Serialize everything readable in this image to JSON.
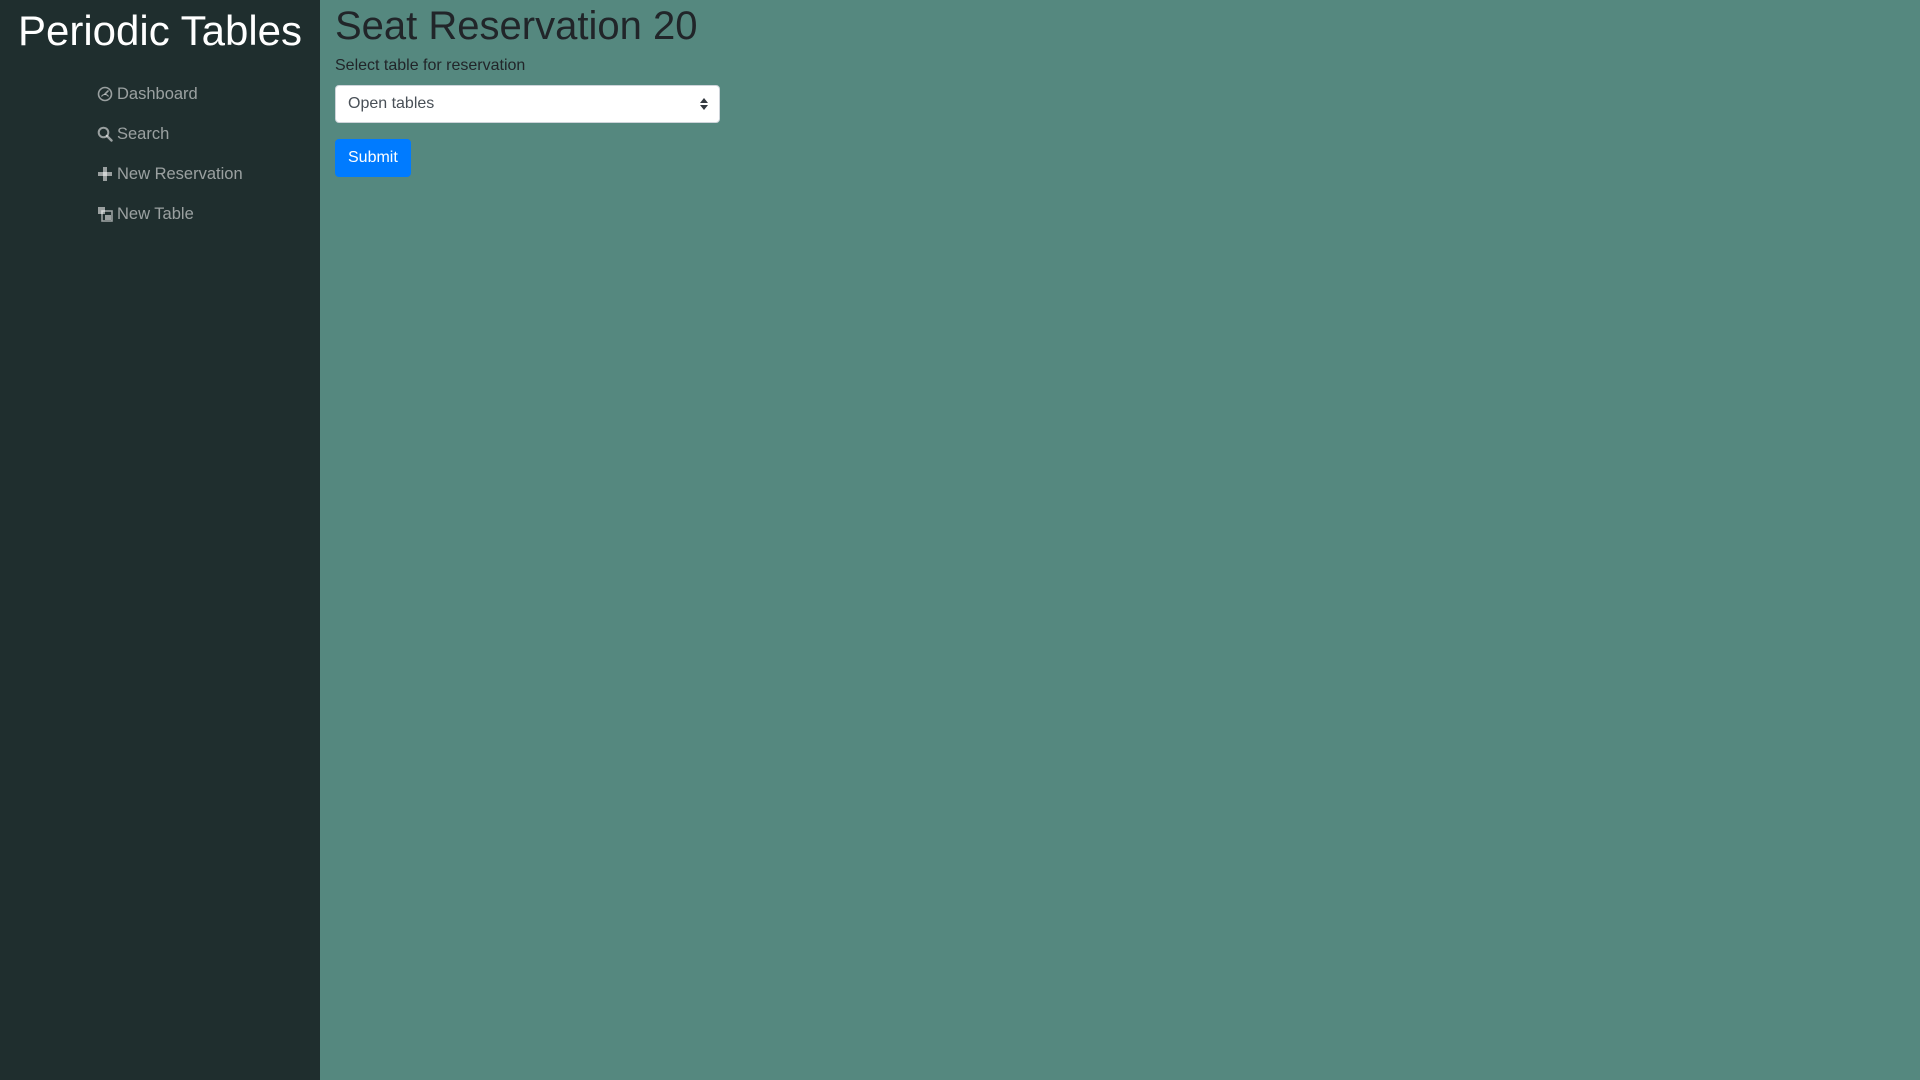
{
  "sidebar": {
    "brand": "Periodic Tables",
    "items": [
      {
        "label": "Dashboard",
        "icon": "dashboard-icon"
      },
      {
        "label": "Search",
        "icon": "search-icon"
      },
      {
        "label": "New Reservation",
        "icon": "plus-icon"
      },
      {
        "label": "New Table",
        "icon": "table-icon"
      }
    ]
  },
  "main": {
    "title": "Seat Reservation 20",
    "form": {
      "label": "Select table for reservation",
      "select_value": "Open tables",
      "submit_label": "Submit"
    }
  },
  "colors": {
    "sidebar_bg": "#1f2e2e",
    "main_bg": "#55887f",
    "primary": "#007bff"
  }
}
